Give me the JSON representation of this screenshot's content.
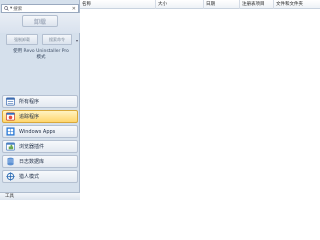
{
  "search": {
    "placeholder": "搜索"
  },
  "uninstall_label": "卸载",
  "quick_uninstall_label": "强制卸载",
  "more_label": "搜索命令",
  "using_text": "使用 Revo Uninstaller Pro",
  "mode_text": "模式",
  "nav": [
    {
      "label": "所有程序"
    },
    {
      "label": "追踪程序"
    },
    {
      "label": "Windows Apps"
    },
    {
      "label": "浏览器插件"
    },
    {
      "label": "日志数据库"
    },
    {
      "label": "猎人模式"
    }
  ],
  "tools_label": "工具",
  "columns": [
    "名称",
    "大小",
    "日期",
    "注册表项目",
    "文件和文件夹"
  ],
  "colors": {
    "active_nav": "#ffd66e",
    "panel": "#d5e0ec"
  }
}
